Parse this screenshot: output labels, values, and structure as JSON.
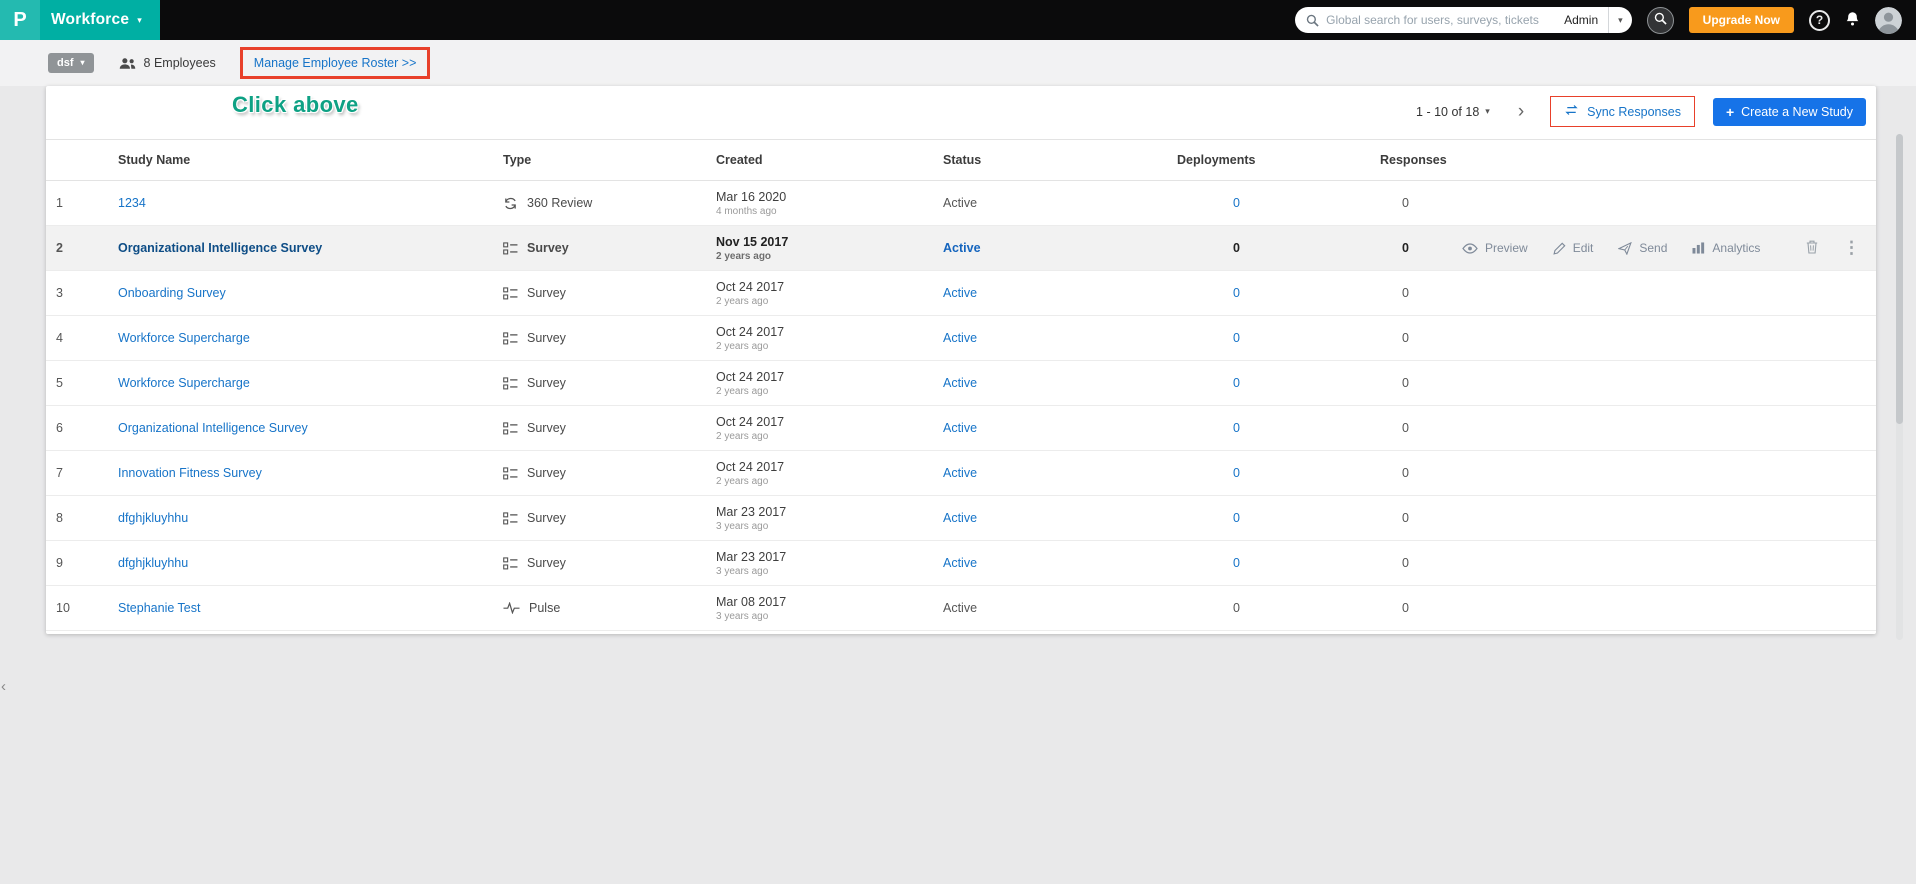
{
  "colors": {
    "teal": "#00AFA3",
    "blue_link": "#1774C8",
    "button_blue": "#1673E8",
    "highlight_red": "#E8402A",
    "orange": "#F89A1C",
    "selected_navy": "#0E4D86"
  },
  "topbar": {
    "logo_glyph": "P",
    "brand": "Workforce",
    "search_placeholder": "Global search for users, surveys, tickets",
    "search_scope": "Admin",
    "upgrade_label": "Upgrade Now"
  },
  "subbar": {
    "project": "dsf",
    "employees_label": "8 Employees",
    "roster_link": "Manage Employee Roster >>"
  },
  "annotation": {
    "text": "Click above"
  },
  "toolbar": {
    "pagination_label": "1 - 10 of 18",
    "sync_label": "Sync Responses",
    "create_label": "Create a New Study"
  },
  "table": {
    "headers": {
      "name": "Study Name",
      "type": "Type",
      "created": "Created",
      "status": "Status",
      "deployments": "Deployments",
      "responses": "Responses"
    },
    "actions": {
      "preview": "Preview",
      "edit": "Edit",
      "send": "Send",
      "analytics": "Analytics"
    },
    "rows": [
      {
        "num": "1",
        "name": "1234",
        "type": "360 Review",
        "icon": "360-review",
        "created": "Mar 16 2020",
        "ago": "4 months ago",
        "status": "Active",
        "status_blue": false,
        "dep": "0",
        "dep_blue": true,
        "resp": "0",
        "selected": false
      },
      {
        "num": "2",
        "name": "Organizational Intelligence Survey",
        "type": "Survey",
        "icon": "survey",
        "created": "Nov 15 2017",
        "ago": "2 years ago",
        "status": "Active",
        "status_blue": true,
        "dep": "0",
        "dep_blue": false,
        "resp": "0",
        "selected": true
      },
      {
        "num": "3",
        "name": "Onboarding Survey",
        "type": "Survey",
        "icon": "survey",
        "created": "Oct 24 2017",
        "ago": "2 years ago",
        "status": "Active",
        "status_blue": true,
        "dep": "0",
        "dep_blue": true,
        "resp": "0",
        "selected": false
      },
      {
        "num": "4",
        "name": "Workforce Supercharge",
        "type": "Survey",
        "icon": "survey",
        "created": "Oct 24 2017",
        "ago": "2 years ago",
        "status": "Active",
        "status_blue": true,
        "dep": "0",
        "dep_blue": true,
        "resp": "0",
        "selected": false
      },
      {
        "num": "5",
        "name": "Workforce Supercharge",
        "type": "Survey",
        "icon": "survey",
        "created": "Oct 24 2017",
        "ago": "2 years ago",
        "status": "Active",
        "status_blue": true,
        "dep": "0",
        "dep_blue": true,
        "resp": "0",
        "selected": false
      },
      {
        "num": "6",
        "name": "Organizational Intelligence Survey",
        "type": "Survey",
        "icon": "survey",
        "created": "Oct 24 2017",
        "ago": "2 years ago",
        "status": "Active",
        "status_blue": true,
        "dep": "0",
        "dep_blue": true,
        "resp": "0",
        "selected": false
      },
      {
        "num": "7",
        "name": "Innovation Fitness Survey",
        "type": "Survey",
        "icon": "survey",
        "created": "Oct 24 2017",
        "ago": "2 years ago",
        "status": "Active",
        "status_blue": true,
        "dep": "0",
        "dep_blue": true,
        "resp": "0",
        "selected": false
      },
      {
        "num": "8",
        "name": "dfghjkluyhhu",
        "type": "Survey",
        "icon": "survey",
        "created": "Mar 23 2017",
        "ago": "3 years ago",
        "status": "Active",
        "status_blue": true,
        "dep": "0",
        "dep_blue": true,
        "resp": "0",
        "selected": false
      },
      {
        "num": "9",
        "name": "dfghjkluyhhu",
        "type": "Survey",
        "icon": "survey",
        "created": "Mar 23 2017",
        "ago": "3 years ago",
        "status": "Active",
        "status_blue": true,
        "dep": "0",
        "dep_blue": true,
        "resp": "0",
        "selected": false
      },
      {
        "num": "10",
        "name": "Stephanie Test",
        "type": "Pulse",
        "icon": "pulse",
        "created": "Mar 08 2017",
        "ago": "3 years ago",
        "status": "Active",
        "status_blue": false,
        "dep": "0",
        "dep_blue": false,
        "resp": "0",
        "selected": false
      }
    ]
  }
}
